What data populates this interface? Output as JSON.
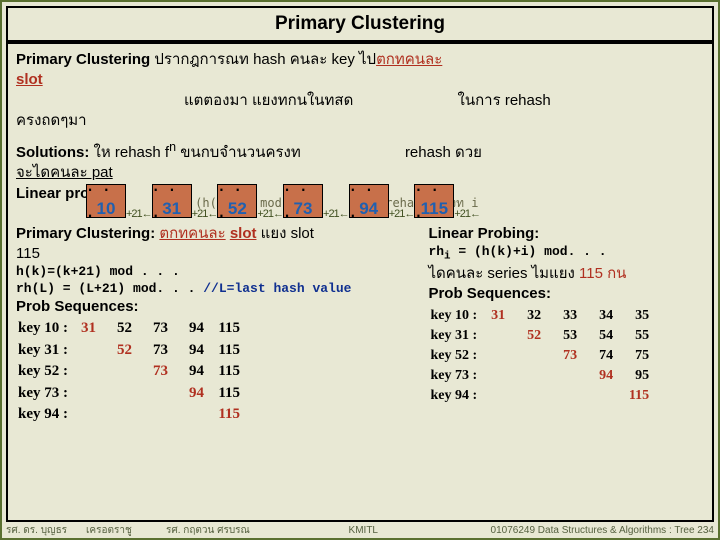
{
  "title": "Primary Clustering",
  "para1": {
    "strong": "Primary Clustering",
    "t1": " ปรากฎการณท",
    "t2": "     hash คนละ key ไป",
    "ul1": "ตกทคนละ",
    "ul2": "slot",
    "t3": "แตตองมา   แยงทกนในทสด",
    "t4": "ในการ rehash",
    "t5": "ครงถดๆมา"
  },
  "para2": {
    "s1": "Solutions:",
    "t1": " ให   rehash f",
    "sup": "n",
    "t2": " ขนกบจำนวนครงท",
    "t3": "rehash ดวย",
    "u1": "จะไดคนละ  pat",
    "lp": "Linear probing",
    "f1": "rh",
    "f2": " = (h(k)+i) mod .",
    "f3": "/* rehash ครงท   i",
    "isub": "i"
  },
  "arr": {
    "n1": "10",
    "a1": "+21←",
    "n2": "31",
    "a2": "+21←",
    "n3": "52",
    "a3": "+21←",
    "n4": "73",
    "a4": "+21←",
    "n5": "94",
    "a5": "+21←",
    "n6": "115",
    "a6": "+21←",
    "dots": ". . ."
  },
  "leftblock": {
    "h1a": "Primary Clustering:",
    "h1b": "ตกทคนละ",
    "h1c": "slot",
    "h1d": " แยง  slot",
    "h2": "115",
    "c1": "h(k)=(k+21) mod . . .",
    "c2": "rh(L) = (L+21) mod. . . ",
    "c2c": "//L=last hash value",
    "ps": "Prob Sequences:",
    "rows": [
      {
        "k": "key 10 :",
        "v": [
          "31",
          "52",
          "73",
          "94",
          "115"
        ]
      },
      {
        "k": "key 31 :",
        "v": [
          "",
          "52",
          "73",
          "94",
          "115"
        ]
      },
      {
        "k": "key 52 :",
        "v": [
          "",
          "",
          "73",
          "94",
          "115"
        ]
      },
      {
        "k": "key 73 :",
        "v": [
          "",
          "",
          "",
          "94",
          "115"
        ]
      },
      {
        "k": "key 94 :",
        "v": [
          "",
          "",
          "",
          "",
          "115"
        ]
      }
    ]
  },
  "rightblock": {
    "h1": "Linear Probing:",
    "c1": "rh",
    "c1s": "i",
    "c1b": " = (h(k)+i) mod. . .",
    "t2a": "ไดคนละ series ไมแยง",
    "t2b": "115 กน",
    "ps": "Prob Sequences:",
    "rows": [
      {
        "k": "key 10 :",
        "v": [
          "31",
          "32",
          "33",
          "34",
          "35"
        ]
      },
      {
        "k": "key 31 :",
        "v": [
          "",
          "52",
          "53",
          "54",
          "55"
        ]
      },
      {
        "k": "key 52 :",
        "v": [
          "",
          "",
          "73",
          "74",
          "75"
        ]
      },
      {
        "k": "key 73 :",
        "v": [
          "",
          "",
          "",
          "94",
          "95"
        ]
      },
      {
        "k": "key 94 :",
        "v": [
          "",
          "",
          "",
          "",
          "115"
        ]
      }
    ]
  },
  "footer": {
    "a": "รศ. ดร. บุญธร",
    "b": "เครอตราชู",
    "c": "รศ. กฤตวน    ศรบรณ",
    "d": "KMITL",
    "e": "01076249 Data Structures & Algorithms : Tree 234"
  }
}
